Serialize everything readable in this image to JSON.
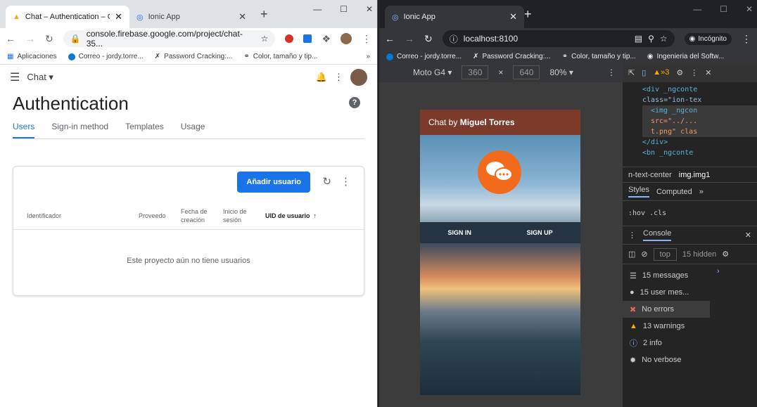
{
  "left_tabs": [
    {
      "title": "Chat – Authentication – Cons",
      "active": true
    },
    {
      "title": "Ionic App",
      "active": false
    }
  ],
  "left_url": "console.firebase.google.com/project/chat-35...",
  "bookmarks_left": [
    "Aplicaciones",
    "Correo - jordy.torre...",
    "Password Cracking:...",
    "Color, tamaño y tip..."
  ],
  "right_tab": "Ionic App",
  "right_url": "localhost:8100",
  "incognito": "Incógnito",
  "bookmarks_right": [
    "Correo - jordy.torre...",
    "Password Cracking:...",
    "Color, tamaño y tip...",
    "Ingenieria del Softw..."
  ],
  "firebase": {
    "project": "Chat",
    "title": "Authentication",
    "tabs": [
      "Users",
      "Sign-in method",
      "Templates",
      "Usage"
    ],
    "add_user": "Añadir usuario",
    "columns": [
      "Identificador",
      "Proveedo",
      "Fecha de creación",
      "Inicio de sesión",
      "UID de usuario"
    ],
    "empty": "Este proyecto aún no tiene usuarios"
  },
  "device": {
    "name": "Moto G4",
    "width": "360",
    "height": "640",
    "zoom": "80%"
  },
  "app": {
    "header_prefix": "Chat by ",
    "header_name": "Miguel Torres",
    "sign_in": "SIGN IN",
    "sign_up": "SIGN UP"
  },
  "devtools": {
    "warnings_badge": "3",
    "html1": "<div _ngconte",
    "html2": "class=\"ion-tex",
    "html3": "<img _ngcon",
    "html4": "src=\"../...",
    "html5": "t.png\" clas",
    "html6": "</div>",
    "html7": "<bn _ngconte",
    "crumb1": "n-text-center",
    "crumb2": "img.img1",
    "styles_tab": "Styles",
    "computed_tab": "Computed",
    "filter": ":hov .cls",
    "console_tab": "Console",
    "context": "top",
    "hidden": "15 hidden",
    "messages": [
      "15 messages",
      "15 user mes...",
      "No errors",
      "13 warnings",
      "2 info",
      "No verbose"
    ]
  }
}
